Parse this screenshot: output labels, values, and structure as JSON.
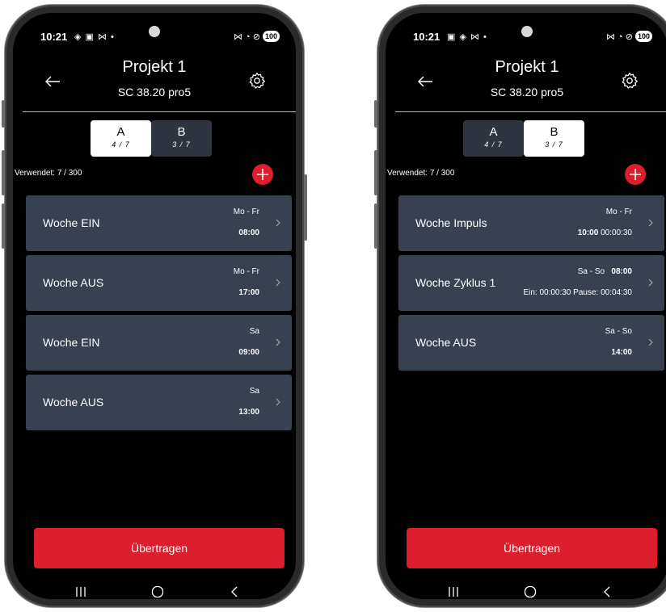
{
  "phones": [
    {
      "status": {
        "time": "10:21",
        "left_icons": "◈ ▣ ⋈ •",
        "right_icons": "⋈ ◔ ⊘",
        "battery": "100"
      },
      "header": {
        "title": "Projekt 1",
        "subtitle": "SC 38.20 pro5"
      },
      "tabs": [
        {
          "label": "A",
          "count": "4 / 7",
          "active": true
        },
        {
          "label": "B",
          "count": "3 / 7",
          "active": false
        }
      ],
      "used_label": "Verwendet:  7 / 300",
      "items": [
        {
          "name": "Woche EIN",
          "days": "Mo - Fr",
          "time": "08:00"
        },
        {
          "name": "Woche AUS",
          "days": "Mo - Fr",
          "time": "17:00"
        },
        {
          "name": "Woche EIN",
          "days": "Sa",
          "time": "09:00"
        },
        {
          "name": "Woche AUS",
          "days": "Sa",
          "time": "13:00"
        }
      ],
      "transfer_label": "Übertragen"
    },
    {
      "status": {
        "time": "10:21",
        "left_icons": "▣ ◈ ⋈ •",
        "right_icons": "⋈ ◔ ⊘",
        "battery": "100"
      },
      "header": {
        "title": "Projekt 1",
        "subtitle": "SC 38.20 pro5"
      },
      "tabs": [
        {
          "label": "A",
          "count": "4 / 7",
          "active": false
        },
        {
          "label": "B",
          "count": "3 / 7",
          "active": true
        }
      ],
      "used_label": "Verwendet:  7 / 300",
      "items": [
        {
          "name": "Woche Impuls",
          "days": "Mo - Fr",
          "time_bold": "10:00",
          "time_rest": "00:00:30"
        },
        {
          "name": "Woche Zyklus 1",
          "days": "Sa - So",
          "days_time": "08:00",
          "detail": "Ein: 00:00:30  Pause: 00:04:30"
        },
        {
          "name": "Woche AUS",
          "days": "Sa - So",
          "time": "14:00"
        }
      ],
      "transfer_label": "Übertragen"
    }
  ],
  "colors": {
    "accent_red": "#dc1e2d",
    "card": "#374150",
    "tab_inactive": "#2f3540"
  }
}
